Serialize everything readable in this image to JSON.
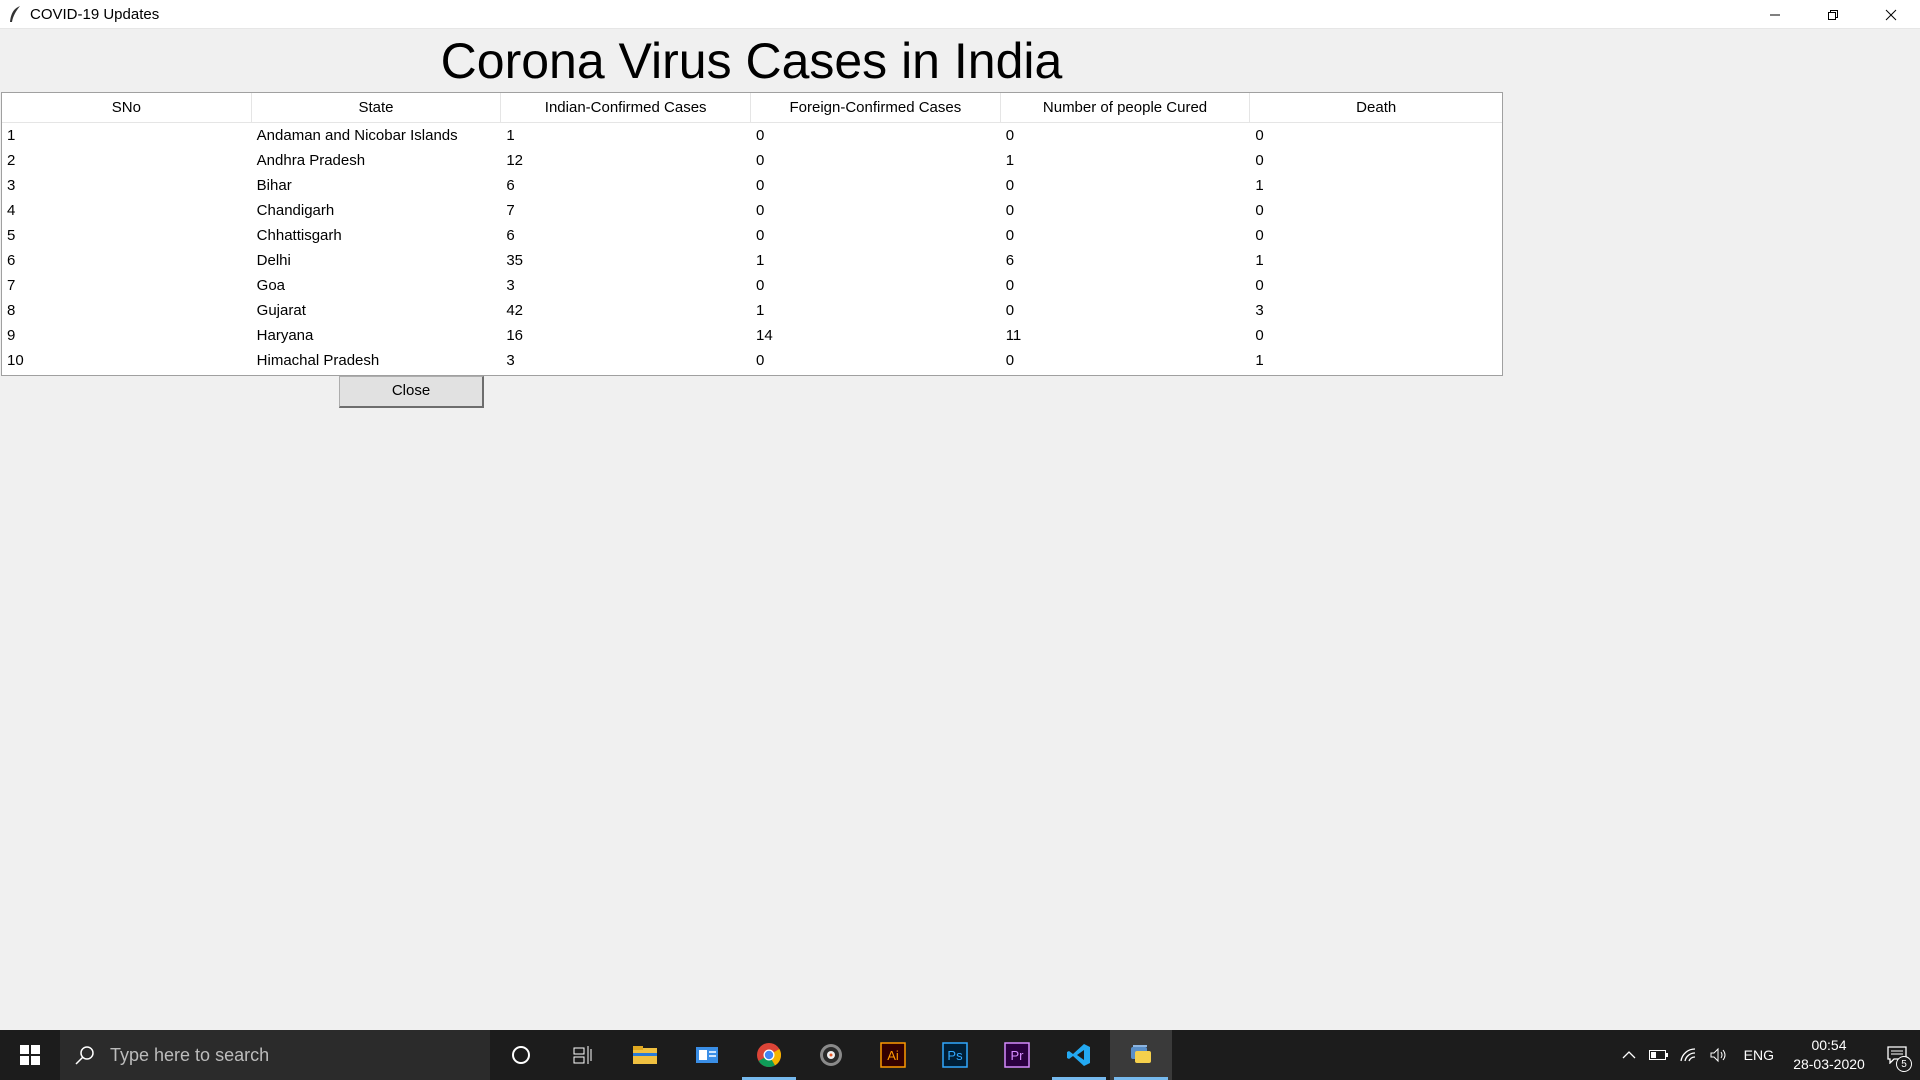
{
  "window": {
    "title": "COVID-19 Updates",
    "app_icon": "feather-icon"
  },
  "page": {
    "heading": "Corona Virus Cases in India",
    "close_label": "Close"
  },
  "table": {
    "columns": [
      "SNo",
      "State",
      "Indian-Confirmed Cases",
      "Foreign-Confirmed Cases",
      "Number of people Cured",
      "Death"
    ],
    "rows": [
      [
        "1",
        "Andaman and Nicobar Islands",
        "1",
        "0",
        "0",
        "0"
      ],
      [
        "2",
        "Andhra Pradesh",
        "12",
        "0",
        "1",
        "0"
      ],
      [
        "3",
        "Bihar",
        "6",
        "0",
        "0",
        "1"
      ],
      [
        "4",
        "Chandigarh",
        "7",
        "0",
        "0",
        "0"
      ],
      [
        "5",
        "Chhattisgarh",
        "6",
        "0",
        "0",
        "0"
      ],
      [
        "6",
        "Delhi",
        "35",
        "1",
        "6",
        "1"
      ],
      [
        "7",
        "Goa",
        "3",
        "0",
        "0",
        "0"
      ],
      [
        "8",
        "Gujarat",
        "42",
        "1",
        "0",
        "3"
      ],
      [
        "9",
        "Haryana",
        "16",
        "14",
        "11",
        "0"
      ],
      [
        "10",
        "Himachal Pradesh",
        "3",
        "0",
        "0",
        "1"
      ]
    ]
  },
  "taskbar": {
    "search_placeholder": "Type here to search",
    "apps": [
      "cortana-icon",
      "task-view-icon",
      "file-explorer-icon",
      "outlook-icon",
      "chrome-icon",
      "media-player-icon",
      "illustrator-icon",
      "photoshop-icon",
      "premiere-icon",
      "vscode-icon",
      "python-icon"
    ],
    "illustrator_label": "Ai",
    "photoshop_label": "Ps",
    "premiere_label": "Pr",
    "language": "ENG",
    "time": "00:54",
    "date": "28-03-2020",
    "notification_count": "5"
  }
}
